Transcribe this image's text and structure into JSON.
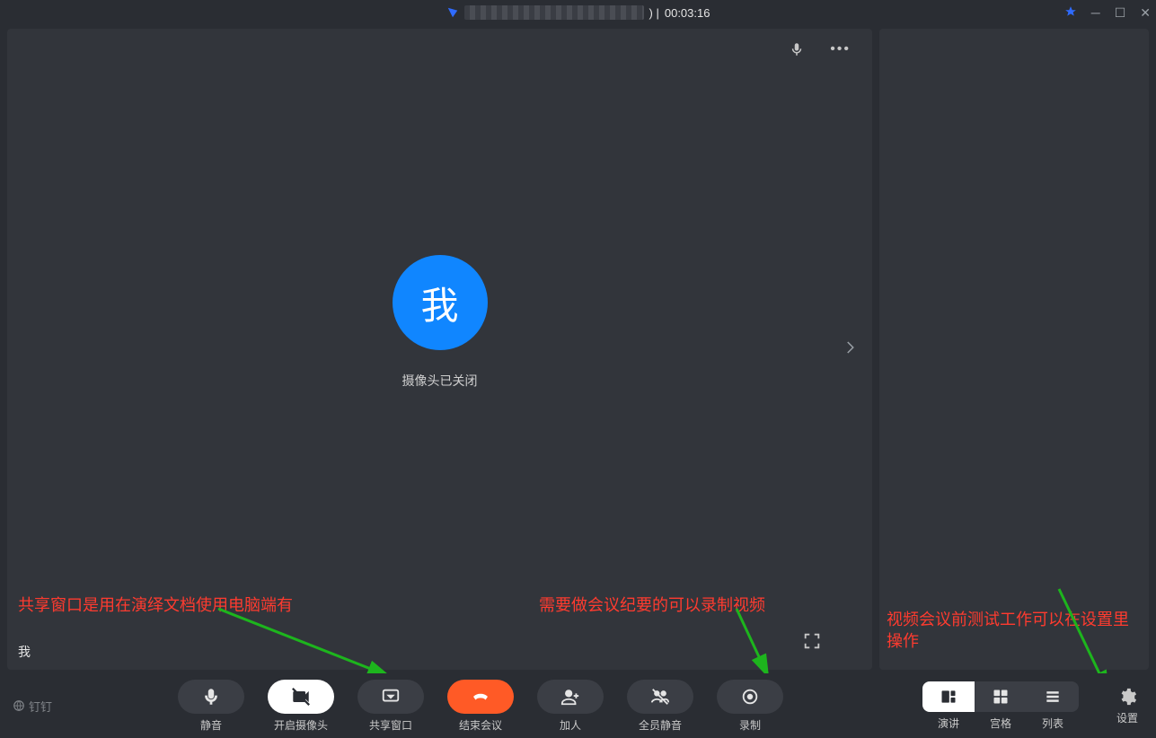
{
  "titlebar": {
    "timer": "00:03:16",
    "separator": ") |"
  },
  "video_pane": {
    "avatar_text": "我",
    "camera_off_label": "摄像头已关闭",
    "me_label": "我"
  },
  "annotations": {
    "share_window": "共享窗口是用在演绎文档使用电脑端有",
    "record": "需要做会议纪要的可以录制视频",
    "settings": "视频会议前测试工作可以在设置里操作"
  },
  "brand": "钉钉",
  "toolbar": {
    "mute": "静音",
    "camera": "开启摄像头",
    "share": "共享窗口",
    "end": "结束会议",
    "add": "加人",
    "mute_all": "全员静音",
    "record": "录制"
  },
  "view": {
    "speaker": "演讲",
    "grid": "宫格",
    "list": "列表",
    "settings": "设置"
  }
}
